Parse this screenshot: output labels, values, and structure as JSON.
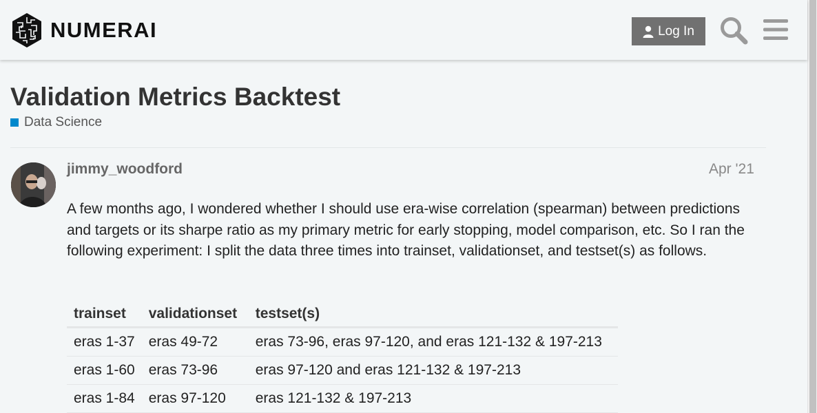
{
  "header": {
    "brand": "NUMERAI",
    "login_label": "Log In"
  },
  "topic": {
    "title": "Validation Metrics Backtest",
    "category": "Data Science",
    "category_color": "#0088cc"
  },
  "post": {
    "username": "jimmy_woodford",
    "date": "Apr '21",
    "body": "A few months ago, I wondered whether I should use era-wise correlation (spearman) between predictions and targets or its sharpe ratio as my primary metric for early stopping, model comparison, etc. So I ran the following experiment: I split the data three times into trainset, validationset, and testset(s) as follows."
  },
  "table": {
    "headers": [
      "trainset",
      "validationset",
      "testset(s)"
    ],
    "rows": [
      [
        "eras 1-37",
        "eras 49-72",
        "eras 73-96, eras 97-120, and eras 121-132 & 197-213"
      ],
      [
        "eras 1-60",
        "eras 73-96",
        "eras 97-120 and eras 121-132 & 197-213"
      ],
      [
        "eras 1-84",
        "eras 97-120",
        "eras 121-132 & 197-213"
      ]
    ]
  },
  "colors": {
    "login_button": "#717171",
    "background": "#f3f6f7"
  }
}
